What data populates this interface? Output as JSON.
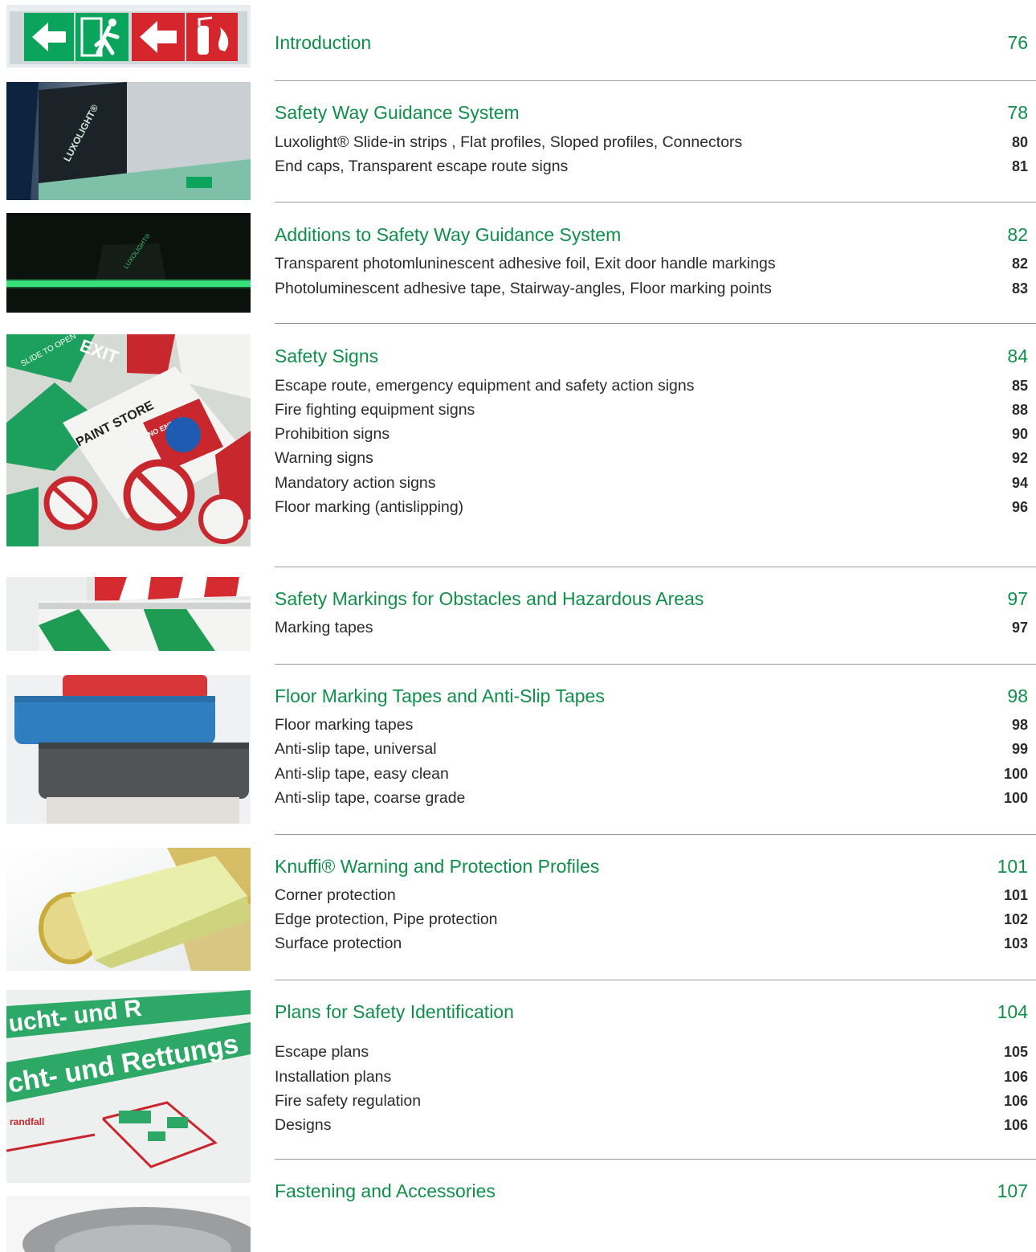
{
  "images": {
    "escape_route_signs": {
      "icon": "running-man-icon"
    },
    "luxolight_corridor": {
      "label": "LUXOLIGHT®"
    },
    "glowing_corridor": {
      "label": "LUXOLIGHT®"
    },
    "sign_pile": {
      "labels": [
        "PAINT STORE",
        "NO ENTRY",
        "EXIT",
        "SLIDE TO OPEN"
      ]
    },
    "marking_tape": {},
    "tape_rolls": {},
    "knuffi_profile": {},
    "escape_plan": {
      "labels": [
        "cht- und Rettungs",
        "ucht- und R",
        "randfall"
      ]
    },
    "fastening_tape": {}
  },
  "sections": [
    {
      "title": "Introduction",
      "page": "76",
      "items": []
    },
    {
      "title": "Safety Way Guidance System",
      "page": "78",
      "items": [
        {
          "text": "Luxolight® Slide-in strips , Flat profiles, Sloped profiles, Connectors",
          "page": "80"
        },
        {
          "text": "End caps, Transparent escape route signs",
          "page": "81"
        }
      ]
    },
    {
      "title": "Additions to Safety Way Guidance System",
      "page": "82",
      "items": [
        {
          "text": "Transparent photomluninescent adhesive foil, Exit door handle markings",
          "page": "82"
        },
        {
          "text": "Photoluminescent adhesive tape, Stairway-angles, Floor marking points",
          "page": "83"
        }
      ]
    },
    {
      "title": "Safety Signs",
      "page": "84",
      "items": [
        {
          "text": "Escape route, emergency equipment and safety action signs",
          "page": "85"
        },
        {
          "text": "Fire fighting equipment signs",
          "page": "88"
        },
        {
          "text": "Prohibition signs",
          "page": "90"
        },
        {
          "text": "Warning signs",
          "page": "92"
        },
        {
          "text": "Mandatory action signs",
          "page": "94"
        },
        {
          "text": "Floor marking (antislipping)",
          "page": "96"
        }
      ]
    },
    {
      "title": "Safety Markings for Obstacles and Hazardous Areas",
      "page": "97",
      "items": [
        {
          "text": "Marking tapes",
          "page": "97"
        }
      ]
    },
    {
      "title": "Floor Marking Tapes and Anti-Slip Tapes",
      "page": "98",
      "items": [
        {
          "text": "Floor marking tapes",
          "page": "98"
        },
        {
          "text": "Anti-slip tape, universal",
          "page": "99"
        },
        {
          "text": "Anti-slip tape, easy clean",
          "page": "100"
        },
        {
          "text": "Anti-slip tape, coarse grade",
          "page": "100"
        }
      ]
    },
    {
      "title": "Knuffi® Warning and Protection Profiles",
      "page": "101",
      "items": [
        {
          "text": "Corner protection",
          "page": "101"
        },
        {
          "text": "Edge protection, Pipe protection",
          "page": "102"
        },
        {
          "text": "Surface protection",
          "page": "103"
        }
      ]
    },
    {
      "title": "Plans for Safety Identification",
      "page": "104",
      "items": [
        {
          "text": "Escape plans",
          "page": "105"
        },
        {
          "text": "Installation plans",
          "page": "106"
        },
        {
          "text": "Fire safety regulation",
          "page": "106"
        },
        {
          "text": "Designs",
          "page": "106"
        }
      ]
    },
    {
      "title": "Fastening and Accessories",
      "page": "107",
      "items": []
    }
  ],
  "colors": {
    "heading": "#0f8f4a",
    "text": "#2b2b2b",
    "rule": "#9a9a9a",
    "safety_green": "#0aa45c",
    "safety_red": "#d4262c"
  }
}
